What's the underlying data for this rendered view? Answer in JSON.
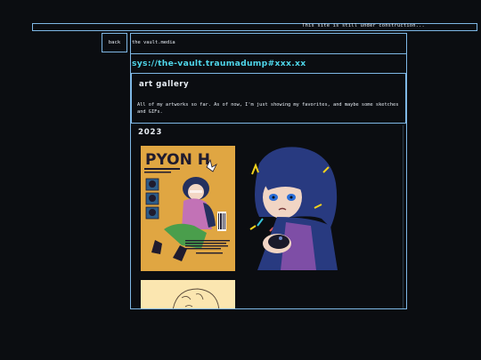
{
  "banner": {
    "text": "This site is still under construction..."
  },
  "nav": {
    "back_label": "back"
  },
  "site": {
    "name": "the vault.media"
  },
  "path": "sys://the-vault.traumadump#xxx.xx",
  "gallery": {
    "title": "art gallery",
    "description": "All of my artworks so far. As of now, I'm just showing my favorites, and maybe some sketches and GIFs.",
    "year": "2023",
    "artworks": [
      {
        "name": "pyon-h-magazine-cover",
        "title_text": "PYON H"
      },
      {
        "name": "blue-haired-character-portrait"
      },
      {
        "name": "character-sketch"
      }
    ]
  },
  "colors": {
    "background": "#0b0d11",
    "border": "#7fb8e6",
    "path_text": "#4fd6ea",
    "text": "#e8eef5"
  }
}
